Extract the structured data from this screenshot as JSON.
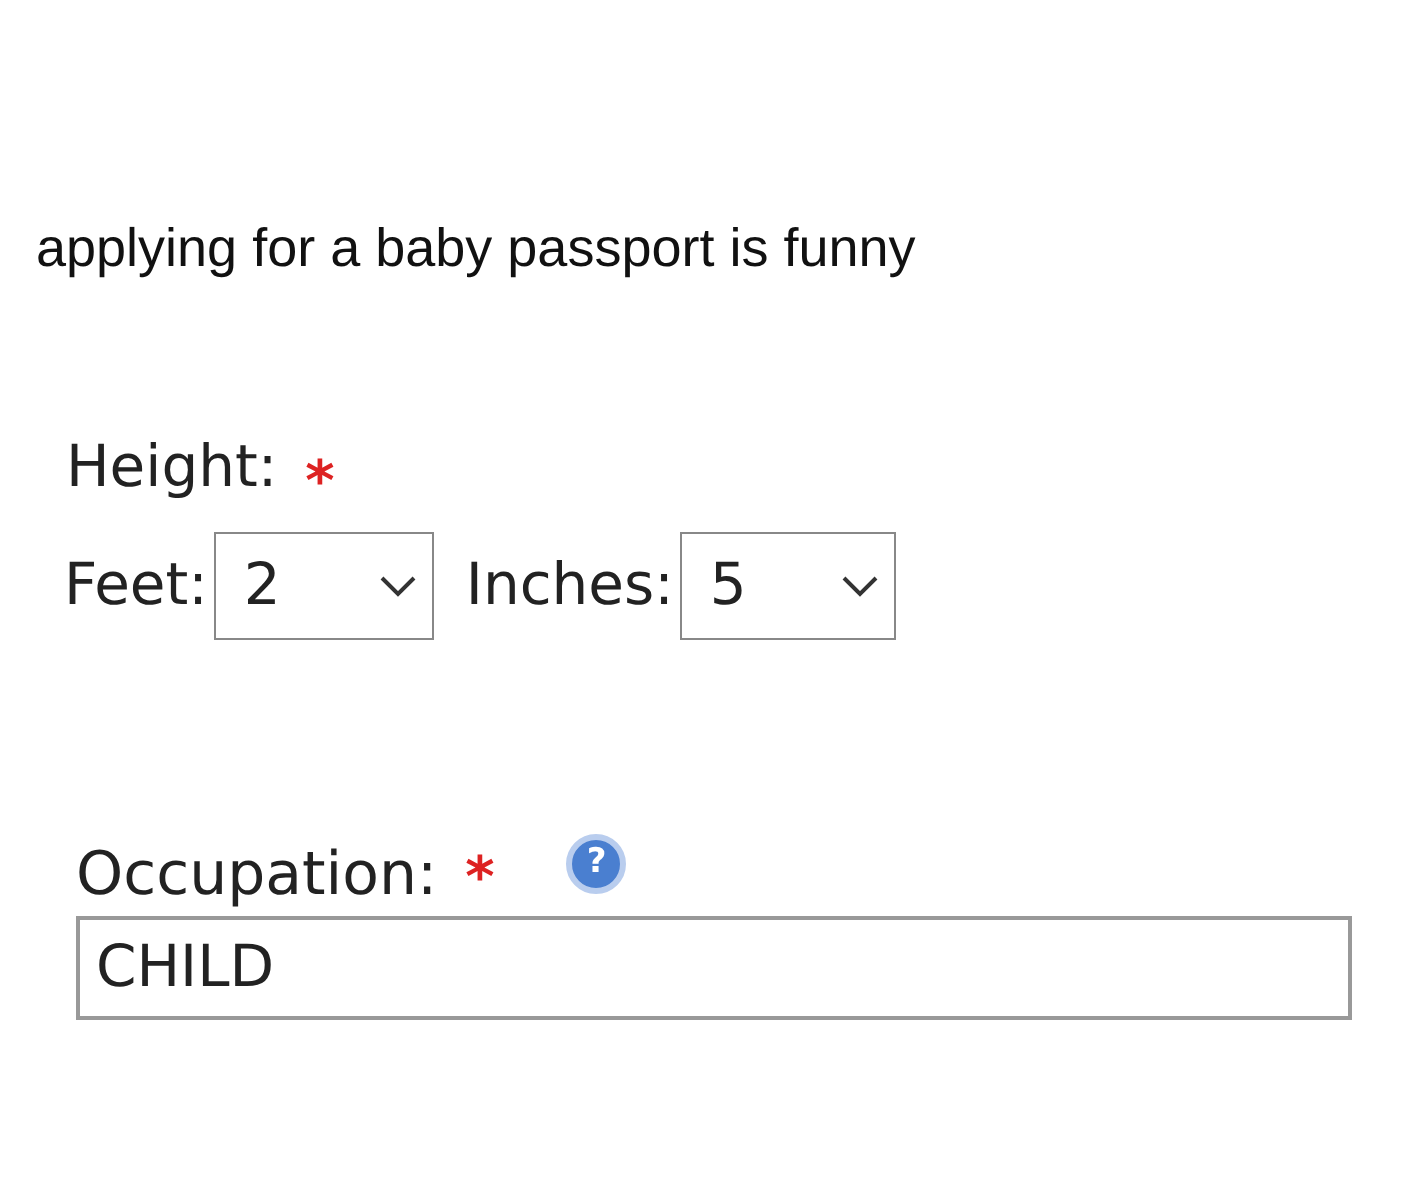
{
  "caption": "applying for a baby passport is funny",
  "height": {
    "label": "Height:",
    "asterisk": "*"
  },
  "feet": {
    "label": "Feet:",
    "value": "2"
  },
  "inches": {
    "label": "Inches:",
    "value": "5"
  },
  "occupation": {
    "label": "Occupation:",
    "asterisk": "*",
    "help": "?",
    "value": "CHILD"
  }
}
